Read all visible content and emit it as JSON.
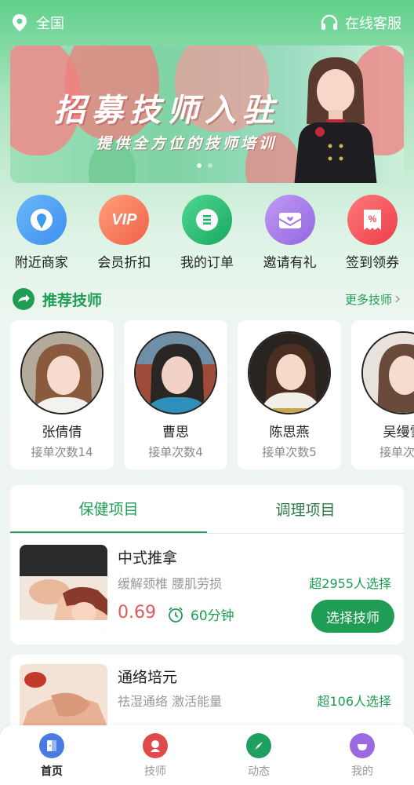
{
  "topbar": {
    "location": "全国",
    "location_icon": "location-pin-icon",
    "service": "在线客服",
    "service_icon": "headset-icon"
  },
  "banner": {
    "title": "招募技师入驻",
    "subtitle": "提供全方位的技师培训",
    "slide_count": 2,
    "active_slide": 1
  },
  "quick_menu": [
    {
      "label": "附近商家",
      "icon": "location-pin-icon",
      "color": "#3d9bf0"
    },
    {
      "label": "会员折扣",
      "icon": "vip-icon",
      "color": "#f26b4a"
    },
    {
      "label": "我的订单",
      "icon": "order-list-icon",
      "color": "#1fb86e"
    },
    {
      "label": "邀请有礼",
      "icon": "invite-envelope-icon",
      "color": "#a678e8"
    },
    {
      "label": "签到领券",
      "icon": "coupon-percent-icon",
      "color": "#f0505a"
    }
  ],
  "recommend": {
    "title": "推荐技师",
    "more": "更多技师"
  },
  "technicians": [
    {
      "name": "张倩倩",
      "count": "接单次数14"
    },
    {
      "name": "曹思",
      "count": "接单次数4"
    },
    {
      "name": "陈思燕",
      "count": "接单次数5"
    },
    {
      "name": "吴缦雪",
      "count": "接单次数"
    }
  ],
  "tabs": [
    {
      "label": "保健项目",
      "active": true
    },
    {
      "label": "调理项目",
      "active": false
    }
  ],
  "services": [
    {
      "name": "中式推拿",
      "desc": "缓解颈椎 腰肌劳损",
      "selected": "超2955人选择",
      "price": "0.69",
      "duration": "60分钟",
      "button": "选择技师"
    },
    {
      "name": "通络培元",
      "desc": "祛湿通络 激活能量",
      "selected": "超106人选择"
    }
  ],
  "bottom_nav": [
    {
      "label": "首页",
      "icon": "home-door-icon",
      "color": "#4a7be0",
      "active": true
    },
    {
      "label": "技师",
      "icon": "technician-icon",
      "color": "#e04a4a",
      "active": false
    },
    {
      "label": "动态",
      "icon": "compass-icon",
      "color": "#1fa060",
      "active": false
    },
    {
      "label": "我的",
      "icon": "profile-icon",
      "color": "#9a6ae0",
      "active": false
    }
  ],
  "colors": {
    "accent": "#1f9d55",
    "price": "#e05a5a"
  }
}
